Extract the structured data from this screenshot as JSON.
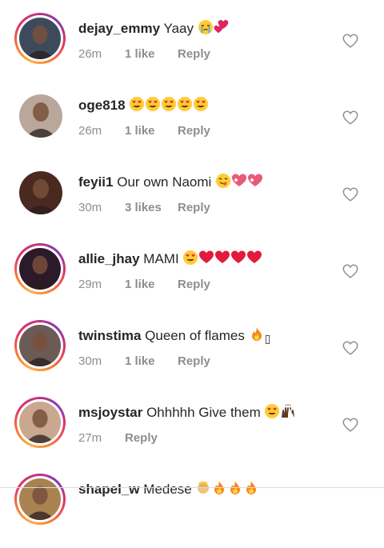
{
  "comments": [
    {
      "username": "dejay_emmy",
      "text": "Yaay",
      "emoji": [
        "crying-face",
        "two-hearts"
      ],
      "time": "26m",
      "likes": "1 like",
      "reply": "Reply",
      "story": true,
      "avatar_color": "#3d4a5c"
    },
    {
      "username": "oge818",
      "text": "",
      "emoji": [
        "heart-eyes",
        "heart-eyes",
        "heart-eyes",
        "heart-eyes",
        "heart-eyes"
      ],
      "time": "26m",
      "likes": "1 like",
      "reply": "Reply",
      "story": false,
      "avatar_color": "#b9a79b"
    },
    {
      "username": "feyii1",
      "text": "Our own Naomi",
      "emoji": [
        "yum-face",
        "sparkling-heart",
        "sparkling-heart"
      ],
      "time": "30m",
      "likes": "3 likes",
      "reply": "Reply",
      "story": false,
      "avatar_color": "#4a2a20"
    },
    {
      "username": "allie_jhay",
      "text": "MAMI",
      "emoji": [
        "heart-eyes",
        "red-heart",
        "red-heart",
        "red-heart",
        "red-heart"
      ],
      "time": "29m",
      "likes": "1 like",
      "reply": "Reply",
      "story": true,
      "avatar_color": "#2b1a2a"
    },
    {
      "username": "twinstima",
      "text": "Queen of flames",
      "emoji": [
        "fire",
        "missing-glyph"
      ],
      "time": "30m",
      "likes": "1 like",
      "reply": "Reply",
      "story": true,
      "avatar_color": "#6b5a55"
    },
    {
      "username": "msjoystar",
      "text": "Ohhhhh Give them",
      "emoji": [
        "heart-eyes",
        "raised-hands"
      ],
      "time": "27m",
      "likes": "",
      "reply": "Reply",
      "story": true,
      "avatar_color": "#c9a88f"
    },
    {
      "username": "shapel_w",
      "text": "Medese",
      "emoji": [
        "baby-angel",
        "fire",
        "fire",
        "fire"
      ],
      "time": "",
      "likes": "",
      "reply": "",
      "story": true,
      "avatar_color": "#a9824f"
    }
  ],
  "missing_glyph": "▯",
  "colors": {
    "text": "#262626",
    "meta": "#8e8e8e",
    "divider": "#dbdbdb"
  }
}
